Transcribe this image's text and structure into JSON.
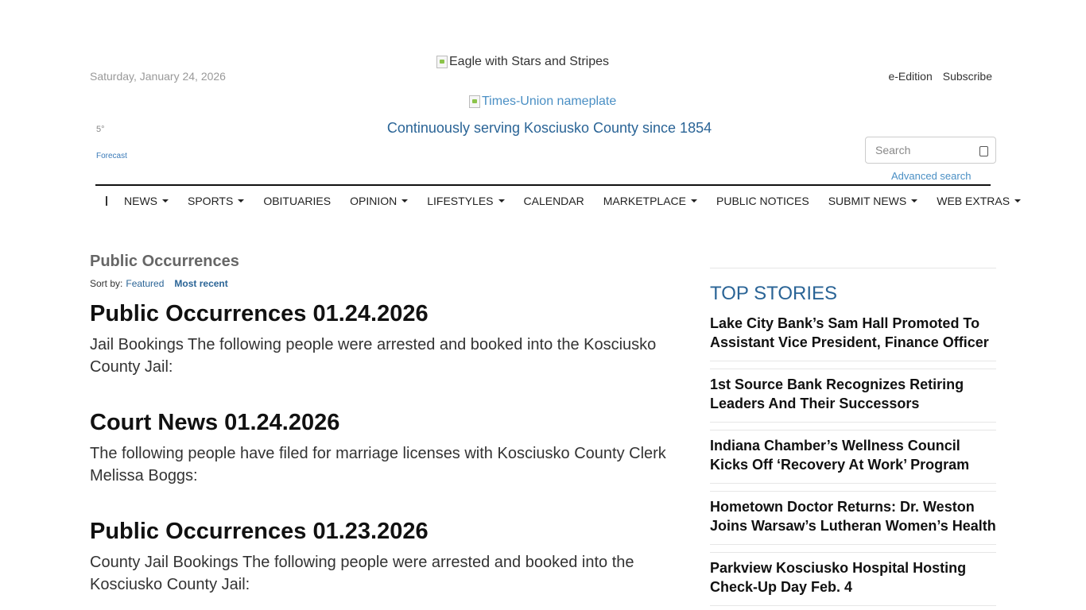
{
  "header": {
    "date": "Saturday, January 24, 2026",
    "eagle_alt": "Eagle with Stars and Stripes",
    "nameplate_alt": "Times-Union nameplate",
    "tagline": "Continuously serving Kosciusko County since 1854",
    "links": {
      "e_edition": "e-Edition",
      "subscribe": "Subscribe"
    }
  },
  "weather": {
    "temp": "5°",
    "forecast": "Forecast"
  },
  "search": {
    "placeholder": "Search",
    "advanced": "Advanced search"
  },
  "nav": {
    "items": [
      {
        "label": "NEWS"
      },
      {
        "label": "SPORTS"
      },
      {
        "label": "OBITUARIES"
      },
      {
        "label": "OPINION"
      },
      {
        "label": "LIFESTYLES"
      },
      {
        "label": "CALENDAR"
      },
      {
        "label": "MARKETPLACE"
      },
      {
        "label": "PUBLIC NOTICES"
      },
      {
        "label": "SUBMIT NEWS"
      },
      {
        "label": "WEB EXTRAS"
      }
    ]
  },
  "main": {
    "title": "Public Occurrences",
    "sort": {
      "label": "Sort by:",
      "featured": "Featured",
      "recent": "Most recent"
    },
    "articles": [
      {
        "title": "Public Occurrences 01.24.2026",
        "summary": "Jail Bookings The following people were arrested and booked into the Kosciusko County Jail:"
      },
      {
        "title": "Court News 01.24.2026",
        "summary": "The following people have filed for marriage licenses with Kosciusko County Clerk Melissa Boggs:"
      },
      {
        "title": "Public Occurrences 01.23.2026",
        "summary": "County Jail Bookings The following people were arrested and booked into the Kosciusko County Jail:"
      }
    ]
  },
  "sidebar": {
    "heading": "TOP STORIES",
    "stories": [
      {
        "title": "Lake City Bank’s Sam Hall Promoted To Assistant Vice President, Finance Officer"
      },
      {
        "title": "1st Source Bank Recognizes Retiring Leaders And Their Successors"
      },
      {
        "title": "Indiana Chamber’s Wellness Council Kicks Off ‘Recovery At Work’ Program"
      },
      {
        "title": "Hometown Doctor Returns: Dr. Weston Joins Warsaw’s Lutheran Women’s Health"
      },
      {
        "title": "Parkview Kosciusko Hospital Hosting Check-Up Day Feb. 4"
      }
    ]
  }
}
